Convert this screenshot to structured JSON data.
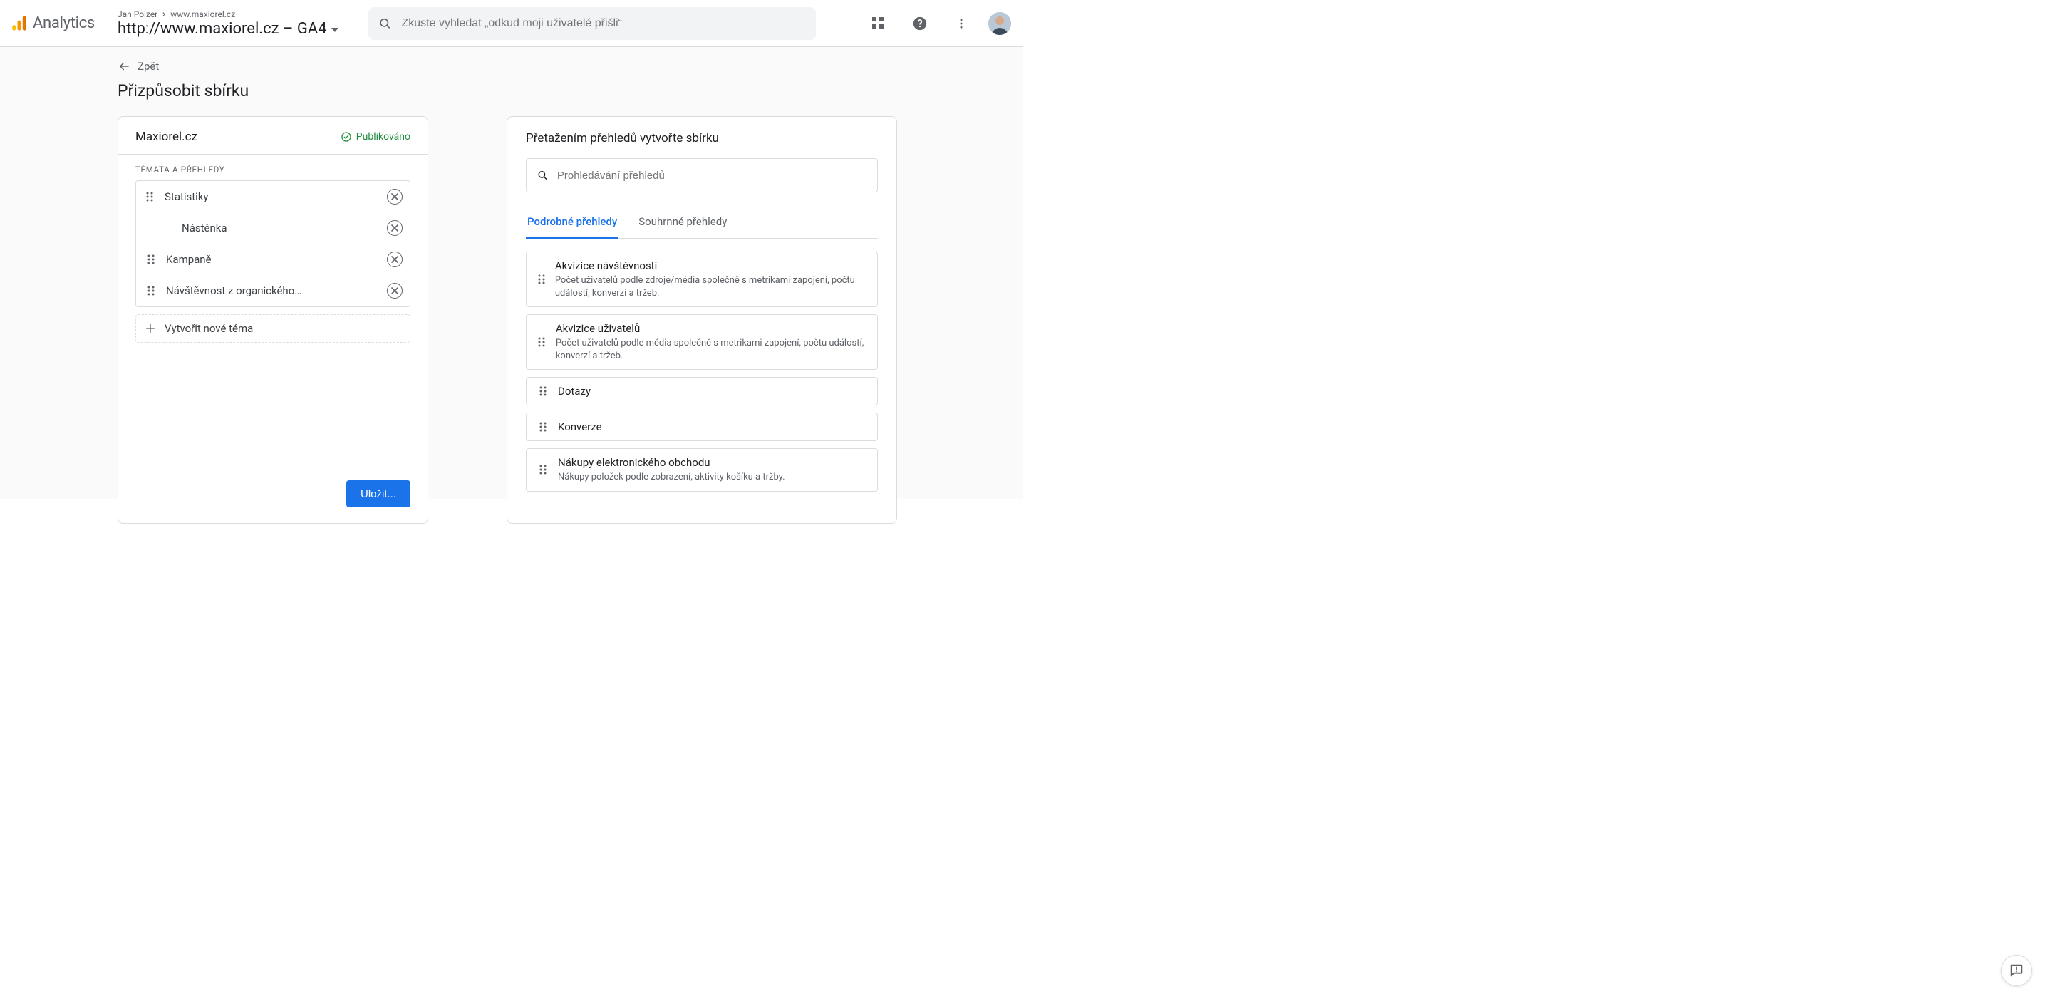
{
  "header": {
    "product": "Analytics",
    "crumb_owner": "Jan Polzer",
    "crumb_site": "www.maxiorel.cz",
    "crumb_title": "http://www.maxiorel.cz – GA4",
    "search_placeholder": "Zkuste vyhledat „odkud moji uživatelé přišli“"
  },
  "page": {
    "back_label": "Zpět",
    "title": "Přizpůsobit sbírku"
  },
  "collection": {
    "name": "Maxiorel.cz",
    "status_label": "Publikováno",
    "section_label": "TÉMATA A PŘEHLEDY",
    "topics": [
      {
        "label": "Statistiky",
        "type": "topic",
        "children": [
          {
            "label": "Nástěnka"
          },
          {
            "label": "Kampaně"
          },
          {
            "label": "Návštěvnost z organického…"
          }
        ]
      }
    ],
    "add_topic_label": "Vytvořit nové téma",
    "save_label": "Uložit..."
  },
  "library": {
    "title": "Přetažením přehledů vytvořte sbírku",
    "search_placeholder": "Prohledávání přehledů",
    "tabs": [
      {
        "label": "Podrobné přehledy",
        "active": true
      },
      {
        "label": "Souhrnné přehledy",
        "active": false
      }
    ],
    "items": [
      {
        "title": "Akvizice návštěvnosti",
        "desc": "Počet uživatelů podle zdroje/média společně s metrikami zapojení, počtu událostí, konverzí a tržeb."
      },
      {
        "title": "Akvizice uživatelů",
        "desc": "Počet uživatelů podle média společně s metrikami zapojení, počtu událostí, konverzí a tržeb."
      },
      {
        "title": "Dotazy",
        "desc": ""
      },
      {
        "title": "Konverze",
        "desc": ""
      },
      {
        "title": "Nákupy elektronického obchodu",
        "desc": "Nákupy položek podle zobrazení, aktivity košíku a tržby."
      }
    ]
  }
}
